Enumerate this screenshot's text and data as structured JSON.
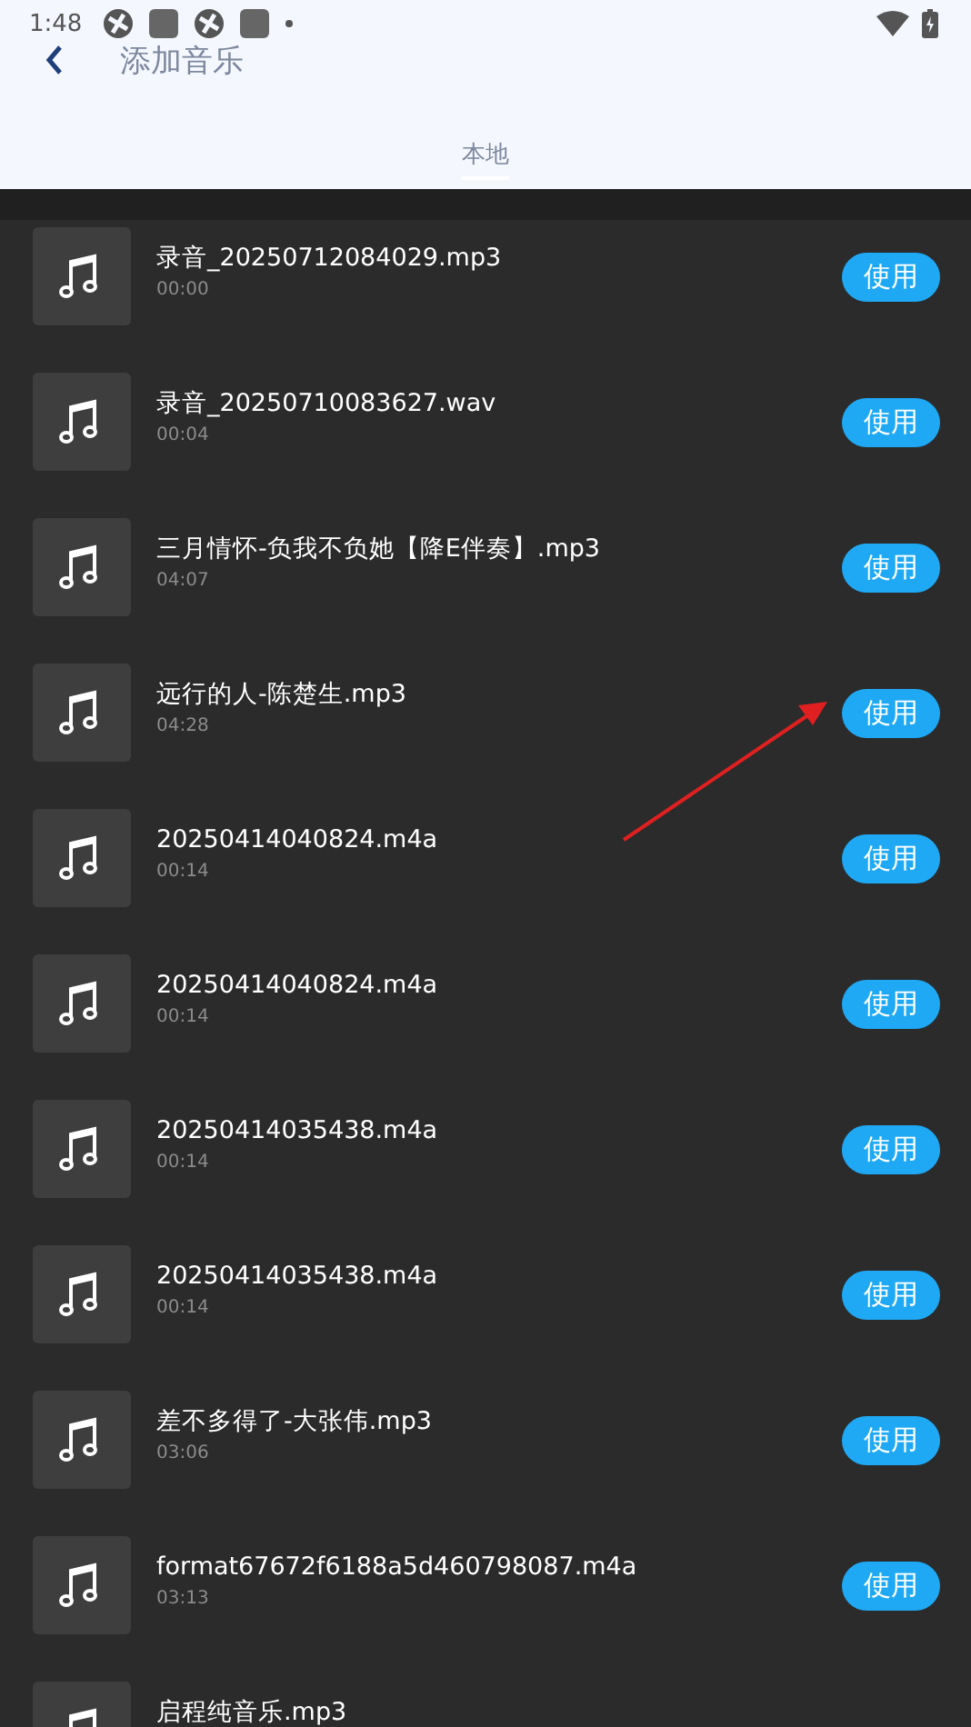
{
  "status_bar": {
    "time": "1:48"
  },
  "header": {
    "title": "添加音乐"
  },
  "tabs": [
    {
      "label": "本地",
      "selected": true
    }
  ],
  "tracks": [
    {
      "name": "录音_20250712084029.mp3",
      "duration": "00:00",
      "action": "使用"
    },
    {
      "name": "录音_20250710083627.wav",
      "duration": "00:04",
      "action": "使用"
    },
    {
      "name": "三月情怀-负我不负她【降E伴奏】.mp3",
      "duration": "04:07",
      "action": "使用"
    },
    {
      "name": "远行的人-陈楚生.mp3",
      "duration": "04:28",
      "action": "使用"
    },
    {
      "name": "20250414040824.m4a",
      "duration": "00:14",
      "action": "使用"
    },
    {
      "name": "20250414040824.m4a",
      "duration": "00:14",
      "action": "使用"
    },
    {
      "name": "20250414035438.m4a",
      "duration": "00:14",
      "action": "使用"
    },
    {
      "name": "20250414035438.m4a",
      "duration": "00:14",
      "action": "使用"
    },
    {
      "name": "差不多得了-大张伟.mp3",
      "duration": "03:06",
      "action": "使用"
    },
    {
      "name": "format67672f6188a5d460798087.m4a",
      "duration": "03:13",
      "action": "使用"
    },
    {
      "name": "启程纯音乐.mp3"
    }
  ]
}
